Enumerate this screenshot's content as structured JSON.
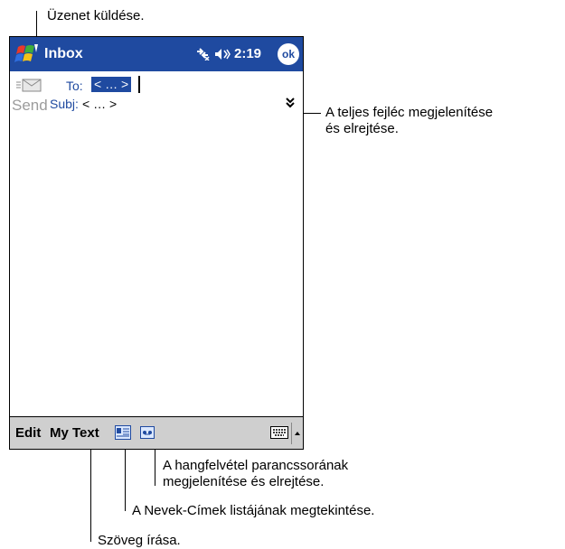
{
  "window": {
    "title": "Inbox",
    "time": "2:19",
    "ok_label": "ok"
  },
  "header": {
    "send_label": "Send",
    "to_label": "To:",
    "to_value": "< … >",
    "subj_label": "Subj:",
    "subj_value": "< … >"
  },
  "menu": {
    "edit": "Edit",
    "my_text": "My Text"
  },
  "icons": {
    "start": "windows-start-icon",
    "signal": "connectivity-icon",
    "speaker": "speaker-icon",
    "send": "send-envelope-icon",
    "expand": "double-chevron-down-icon",
    "contacts": "address-card-icon",
    "recorder": "recorder-icon",
    "keyboard": "keyboard-icon",
    "input_arrow": "arrow-up-icon"
  },
  "colors": {
    "title_bar": "#1f4aa0",
    "menu_bar": "#cfcfcf",
    "send_disabled": "#9c9c9c"
  },
  "callouts": {
    "send": "Üzenet küldése.",
    "header_line1": "A teljes fejléc megjelenítése",
    "header_line2": "és elrejtése.",
    "recorder_line1": "A hangfelvétel parancssorának",
    "recorder_line2": "megjelenítése és elrejtése.",
    "contacts": "A Nevek-Címek listájának megtekintése.",
    "mytext": "Szöveg írása."
  }
}
